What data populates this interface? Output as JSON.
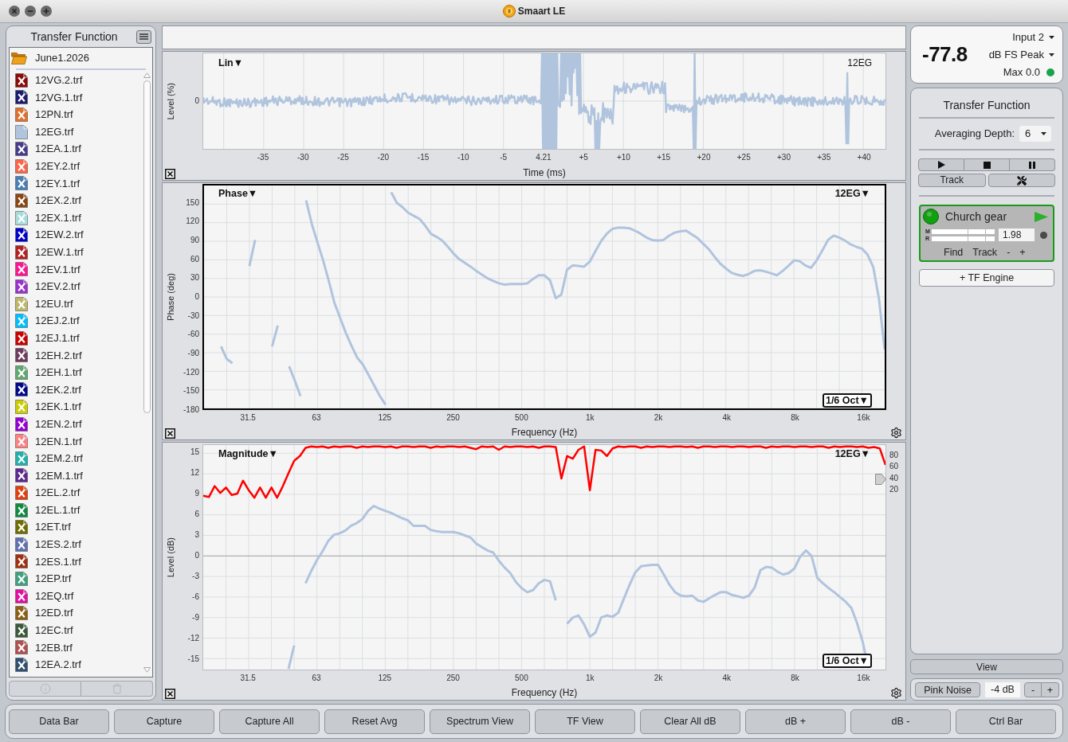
{
  "window": {
    "title": "Smaart LE"
  },
  "sidebar": {
    "title": "Transfer Function",
    "folder": {
      "label": "June1.2026",
      "expanded": true,
      "children": [
        {
          "label": "12VG.2.trf",
          "color": "#8b0a0a",
          "visible": false
        },
        {
          "label": "12VG.1.trf",
          "color": "#1c1c70",
          "visible": false
        },
        {
          "label": "12PN.trf",
          "color": "#e0702a",
          "visible": false
        },
        {
          "label": "12EG.trf",
          "color": "#b0c4de",
          "visible": true
        },
        {
          "label": "12EA.1.trf",
          "color": "#463c8c",
          "visible": false
        },
        {
          "label": "12EY.2.trf",
          "color": "#ff6347",
          "visible": false
        },
        {
          "label": "12EY.1.trf",
          "color": "#4a7fb5",
          "visible": false
        },
        {
          "label": "12EX.2.trf",
          "color": "#8b4513",
          "visible": false
        },
        {
          "label": "12EX.1.trf",
          "color": "#a8dcdc",
          "visible": false
        },
        {
          "label": "12EW.2.trf",
          "color": "#0000cd",
          "visible": false
        },
        {
          "label": "12EW.1.trf",
          "color": "#b22222",
          "visible": false
        },
        {
          "label": "12EV.1.trf",
          "color": "#ff1493",
          "visible": false
        },
        {
          "label": "12EV.2.trf",
          "color": "#9932cc",
          "visible": false
        },
        {
          "label": "12EU.trf",
          "color": "#bdb76b",
          "visible": false
        },
        {
          "label": "12EJ.2.trf",
          "color": "#00bfff",
          "visible": false
        },
        {
          "label": "12EJ.1.trf",
          "color": "#cc0000",
          "visible": false
        },
        {
          "label": "12EH.2.trf",
          "color": "#6e3c5e",
          "visible": false
        },
        {
          "label": "12EH.1.trf",
          "color": "#5fa870",
          "visible": false
        },
        {
          "label": "12EK.2.trf",
          "color": "#00088b",
          "visible": false
        },
        {
          "label": "12EK.1.trf",
          "color": "#cccc00",
          "visible": false
        },
        {
          "label": "12EN.2.trf",
          "color": "#9400d3",
          "visible": false
        },
        {
          "label": "12EN.1.trf",
          "color": "#ff8080",
          "visible": false
        },
        {
          "label": "12EM.2.trf",
          "color": "#20b2aa",
          "visible": false
        },
        {
          "label": "12EM.1.trf",
          "color": "#5c2a8e",
          "visible": false
        },
        {
          "label": "12EL.2.trf",
          "color": "#e0400e",
          "visible": false
        },
        {
          "label": "12EL.1.trf",
          "color": "#108a40",
          "visible": false
        },
        {
          "label": "12ET.trf",
          "color": "#6e6e00",
          "visible": false
        },
        {
          "label": "12ES.2.trf",
          "color": "#6070b0",
          "visible": false
        },
        {
          "label": "12ES.1.trf",
          "color": "#a0300e",
          "visible": false
        },
        {
          "label": "12EP.trf",
          "color": "#40a080",
          "visible": false
        },
        {
          "label": "12EQ.trf",
          "color": "#e010a0",
          "visible": false
        },
        {
          "label": "12ED.trf",
          "color": "#8b6010",
          "visible": false
        },
        {
          "label": "12EC.trf",
          "color": "#3a5a3a",
          "visible": false
        },
        {
          "label": "12EB.trf",
          "color": "#b05050",
          "visible": false
        },
        {
          "label": "12EA.2.trf",
          "color": "#305070",
          "visible": false
        }
      ]
    },
    "actions": [
      {
        "kind": "info",
        "disabled": true
      },
      {
        "kind": "delete",
        "disabled": true
      }
    ]
  },
  "plots": [
    {
      "kind": "impulse",
      "selected": false,
      "mode": "Lin▼",
      "trace": "12EG",
      "ylabel": "Level (%)",
      "yticks": [
        "0"
      ],
      "xticks": [
        "-35",
        "-30",
        "-25",
        "-20",
        "-15",
        "-10",
        "-5",
        "4.21",
        "+5",
        "+10",
        "+15",
        "+20",
        "+25",
        "+30",
        "+35",
        "+40"
      ],
      "xlabel": "Time (ms)"
    },
    {
      "kind": "frequency",
      "selected": true,
      "mode": "Phase▼",
      "trace": "12EG▼",
      "smoothing": "1/6 Oct▼",
      "chart_data": {
        "type": "line",
        "xlabel": "Frequency (Hz)",
        "ylabel": "Phase (deg)",
        "grid": true,
        "categories": [
          null,
          null,
          null,
          null,
          null,
          null,
          null,
          null,
          "31.5",
          null,
          null,
          null,
          null,
          null,
          null,
          null,
          null,
          null,
          null,
          null,
          "63",
          null,
          null,
          null,
          null,
          null,
          null,
          null,
          null,
          null,
          null,
          null,
          "125",
          null,
          null,
          null,
          null,
          null,
          null,
          null,
          null,
          null,
          null,
          null,
          "250",
          null,
          null,
          null,
          null,
          null,
          null,
          null,
          null,
          null,
          null,
          null,
          "500",
          null,
          null,
          null,
          null,
          null,
          null,
          null,
          null,
          null,
          null,
          null,
          "1k",
          null,
          null,
          null,
          null,
          null,
          null,
          null,
          null,
          null,
          null,
          null,
          "2k",
          null,
          null,
          null,
          null,
          null,
          null,
          null,
          null,
          null,
          null,
          null,
          "4k",
          null,
          null,
          null,
          null,
          null,
          null,
          null,
          null,
          null,
          null,
          null,
          "8k",
          null,
          null,
          null,
          null,
          null,
          null,
          null,
          null,
          null,
          null,
          null,
          "16k",
          null,
          null,
          null,
          null
        ],
        "ylim": [
          -180,
          180
        ],
        "yticks": [
          150,
          120,
          90,
          60,
          30,
          0,
          -30,
          -60,
          -90,
          -120,
          -150,
          -180
        ],
        "series": [
          {
            "color": "#b0c4de",
            "values": [
              null,
              null,
              null,
              -80,
              -100,
              -107,
              null,
              null,
              50,
              92,
              null,
              null,
              -80,
              -46,
              null,
              -112,
              -135,
              -160,
              156,
              118,
              88,
              59,
              26,
              -10,
              -34,
              -58,
              -79,
              -98,
              -109,
              -126,
              -143,
              -160,
              -174,
              169,
              152,
              145,
              136,
              131,
              126,
              115,
              102,
              97,
              91,
              81,
              70,
              61,
              55,
              49,
              42,
              36,
              30,
              26,
              22,
              20,
              21,
              21,
              21,
              22,
              29,
              35,
              35,
              27,
              -2,
              4,
              44,
              51,
              50,
              49,
              57,
              74,
              90,
              102,
              110,
              112,
              112,
              111,
              107,
              102,
              96,
              92,
              91,
              92,
              99,
              104,
              106,
              107,
              101,
              95,
              86,
              77,
              65,
              54,
              46,
              39,
              36,
              34,
              37,
              42,
              43,
              41,
              38,
              35,
              42,
              50,
              59,
              58,
              51,
              47,
              59,
              75,
              92,
              99,
              96,
              91,
              85,
              81,
              78,
              68,
              48,
              -4,
              -85
            ]
          }
        ]
      }
    },
    {
      "kind": "frequency",
      "selected": false,
      "mode": "Magnitude▼",
      "trace": "12EG▼",
      "smoothing": "1/6 Oct▼",
      "right_scale": [
        "80",
        "60",
        "40",
        "20"
      ],
      "chart_data": {
        "type": "line",
        "xlabel": "Frequency (Hz)",
        "ylabel": "Level (dB)",
        "grid": true,
        "categories": [
          null,
          null,
          null,
          null,
          null,
          null,
          null,
          null,
          "31.5",
          null,
          null,
          null,
          null,
          null,
          null,
          null,
          null,
          null,
          null,
          null,
          "63",
          null,
          null,
          null,
          null,
          null,
          null,
          null,
          null,
          null,
          null,
          null,
          "125",
          null,
          null,
          null,
          null,
          null,
          null,
          null,
          null,
          null,
          null,
          null,
          "250",
          null,
          null,
          null,
          null,
          null,
          null,
          null,
          null,
          null,
          null,
          null,
          "500",
          null,
          null,
          null,
          null,
          null,
          null,
          null,
          null,
          null,
          null,
          null,
          "1k",
          null,
          null,
          null,
          null,
          null,
          null,
          null,
          null,
          null,
          null,
          null,
          "2k",
          null,
          null,
          null,
          null,
          null,
          null,
          null,
          null,
          null,
          null,
          null,
          "4k",
          null,
          null,
          null,
          null,
          null,
          null,
          null,
          null,
          null,
          null,
          null,
          "8k",
          null,
          null,
          null,
          null,
          null,
          null,
          null,
          null,
          null,
          null,
          null,
          "16k",
          null,
          null,
          null,
          null
        ],
        "ylim": [
          -16.6,
          16.2
        ],
        "yticks": [
          15,
          12,
          9,
          6,
          3,
          0,
          -3,
          -6,
          -9,
          -12,
          -15
        ],
        "series": [
          {
            "color": "#b0c4de",
            "values": [
              null,
              null,
              null,
              null,
              null,
              null,
              null,
              null,
              null,
              null,
              null,
              null,
              null,
              null,
              null,
              -16.5,
              -13.1,
              null,
              -4.0,
              -2.2,
              -0.6,
              0.7,
              2.2,
              3.1,
              3.3,
              3.7,
              4.4,
              4.8,
              5.4,
              6.6,
              7.3,
              6.9,
              6.6,
              6.3,
              5.9,
              5.5,
              5.2,
              4.4,
              4.4,
              4.4,
              3.8,
              3.6,
              3.5,
              3.5,
              3.5,
              3.3,
              3.0,
              2.7,
              1.8,
              1.3,
              0.8,
              0.5,
              -0.7,
              -1.7,
              -2.5,
              -3.8,
              -4.7,
              -5.3,
              -5.0,
              -4.0,
              -3.5,
              -3.7,
              -6.5,
              null,
              -9.9,
              -9.0,
              -8.7,
              -10.0,
              -11.8,
              -11.2,
              -9.0,
              -8.7,
              -8.9,
              -8.3,
              -6.2,
              -4.2,
              -2.4,
              -1.5,
              -1.4,
              -1.3,
              -1.3,
              -2.7,
              -4.2,
              -5.3,
              -5.8,
              -5.9,
              -5.8,
              -6.5,
              -6.7,
              -6.2,
              -5.7,
              -5.3,
              -5.3,
              -5.7,
              -5.9,
              -6.1,
              -5.8,
              -4.6,
              -2.1,
              -1.6,
              -1.7,
              -2.3,
              -2.7,
              -2.5,
              -1.8,
              -0.1,
              0.8,
              0.0,
              -3.2,
              -4.0,
              -4.7,
              -5.3,
              -6.0,
              -6.7,
              -7.6,
              -9.8,
              -12.6,
              -16.4,
              null,
              null,
              null
            ]
          },
          {
            "color": "#ff0000",
            "values": [
              8.8,
              8.6,
              10.2,
              9.2,
              10.0,
              8.9,
              9.1,
              11.0,
              9.6,
              8.5,
              10.0,
              8.5,
              10.0,
              8.5,
              10.2,
              12.1,
              13.9,
              14.6,
              15.8,
              16.0,
              15.9,
              16.0,
              15.8,
              16.0,
              15.9,
              16.0,
              16.0,
              15.8,
              16.0,
              15.9,
              16.0,
              16.0,
              15.9,
              16.0,
              15.8,
              16.0,
              16.0,
              15.9,
              16.0,
              16.0,
              15.8,
              16.0,
              15.9,
              16.0,
              16.0,
              15.9,
              16.0,
              15.8,
              15.6,
              16.0,
              15.9,
              16.0,
              15.5,
              16.0,
              15.9,
              16.0,
              16.0,
              15.9,
              16.0,
              15.8,
              16.0,
              16.0,
              15.9,
              11.3,
              14.6,
              14.2,
              15.5,
              16.0,
              9.6,
              15.5,
              15.4,
              14.6,
              15.7,
              16.0,
              15.9,
              16.0,
              16.0,
              15.8,
              16.0,
              15.9,
              16.0,
              16.0,
              15.9,
              16.0,
              16.0,
              15.9,
              16.0,
              15.8,
              16.0,
              16.0,
              15.9,
              16.0,
              16.0,
              15.9,
              16.0,
              16.0,
              15.9,
              16.0,
              16.0,
              15.8,
              16.0,
              15.9,
              16.0,
              16.0,
              15.9,
              16.0,
              16.0,
              15.9,
              16.0,
              16.0,
              15.8,
              16.0,
              15.9,
              16.0,
              16.0,
              15.9,
              16.0,
              15.8,
              15.9,
              15.7,
              13.3
            ]
          }
        ]
      }
    }
  ],
  "meter": {
    "reading": "-77.8",
    "input": "Input 2",
    "scale": "dB FS Peak",
    "max": "Max 0.0",
    "clipping": false
  },
  "tf_panel": {
    "title": "Transfer Function",
    "averaging_label": "Averaging Depth:",
    "averaging_value": "6",
    "track_button": "Track",
    "engine": {
      "name": "Church gear",
      "on": true,
      "meters": [
        "M",
        "R"
      ],
      "delay": "1.98",
      "actions": [
        "Find",
        "Track",
        "-",
        "+"
      ]
    },
    "add_engine": "+ TF Engine"
  },
  "view_button": "View",
  "generator": {
    "label": "Pink Noise",
    "gain": "-4 dB",
    "steps": [
      "-",
      "+"
    ]
  },
  "toolbar": [
    "Data Bar",
    "Capture",
    "Capture All",
    "Reset Avg",
    "Spectrum View",
    "TF View",
    "Clear All dB",
    "dB +",
    "dB -",
    "Ctrl Bar"
  ]
}
